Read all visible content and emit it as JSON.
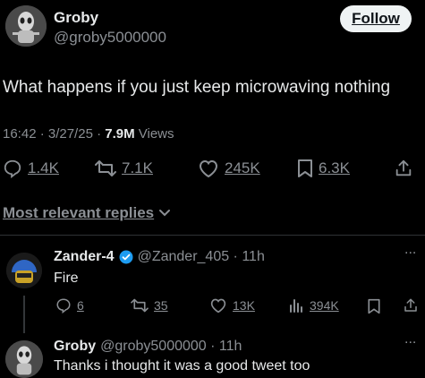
{
  "post": {
    "author_name": "Groby",
    "author_handle": "@groby5000000",
    "follow_label": "Follow",
    "text": "What happens if you just keep microwaving nothing",
    "time": "16:42 · 3/27/25 · ",
    "views_count": "7.9M",
    "views_label": " Views",
    "stats": {
      "replies": "1.4K",
      "reposts": "7.1K",
      "likes": "245K",
      "bookmarks": "6.3K"
    }
  },
  "replies_sort": {
    "label": "Most relevant replies"
  },
  "replies": [
    {
      "name": "Zander-4",
      "handle": "@Zander_405 · 11h",
      "text": "Fire",
      "stats": {
        "replies": "6",
        "reposts": "35",
        "likes": "13K",
        "views": "394K"
      }
    },
    {
      "name": "Groby",
      "handle": "@groby5000000 · 11h",
      "text": "Thanks i thought it was a good tweet too"
    }
  ],
  "more_label": "...",
  "colors": {
    "background": "#000000",
    "text": "#e7e9ea",
    "muted": "#8b8f94",
    "verified": "#1d9bf0"
  }
}
